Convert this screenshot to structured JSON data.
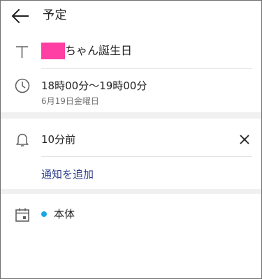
{
  "header": {
    "title": "予定"
  },
  "event": {
    "title_suffix": "ちゃん誕生日"
  },
  "time": {
    "range": "18時00分〜19時00分",
    "date": "6月19日金曜日"
  },
  "notification": {
    "value": "10分前",
    "add_label": "通知を追加"
  },
  "calendar": {
    "name": "本体",
    "color": "#1aa6e8"
  },
  "colors": {
    "redaction": "#ff3fa3",
    "link": "#2f3f8f"
  }
}
